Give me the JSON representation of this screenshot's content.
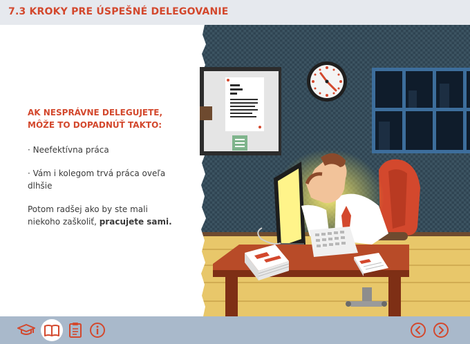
{
  "header": {
    "title": "7.3 KROKY PRE ÚSPEŠNÉ DELEGOVANIE"
  },
  "content": {
    "heading": "Ak nesprávne delegujete, môže to dopadnúť takto:",
    "bullet1": "· Neefektívna práca",
    "bullet2": "· Vám i kolegom trvá práca oveľa dlhšie",
    "outro_prefix": "Potom radšej ako by ste mali niekoho zaškoliť, ",
    "outro_bold": "pracujete sami."
  },
  "colors": {
    "accent": "#d3482d",
    "footer": "#a9b9cb",
    "header": "#e6e9ee"
  },
  "footer": {
    "icons": [
      "graduation-cap-icon",
      "book-icon",
      "clipboard-icon",
      "info-icon"
    ],
    "nav": [
      "prev-arrow-icon",
      "next-arrow-icon"
    ]
  }
}
